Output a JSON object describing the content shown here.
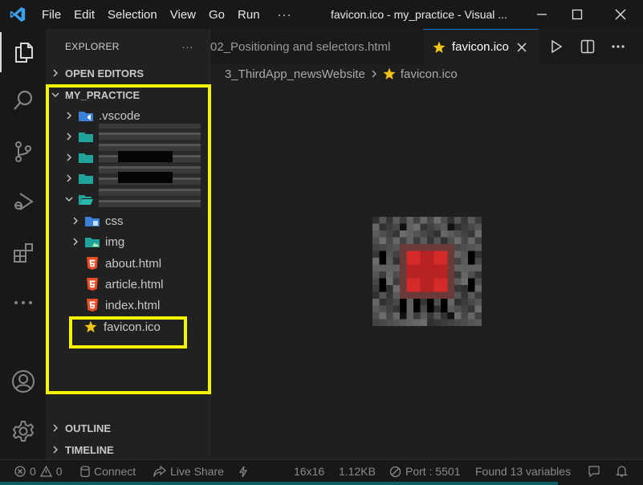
{
  "titlebar": {
    "menu": [
      "File",
      "Edit",
      "Selection",
      "View",
      "Go",
      "Run",
      "···"
    ],
    "window_title": "favicon.ico - my_practice - Visual ..."
  },
  "activity_bar": {
    "icons": [
      "explorer-icon",
      "search-icon",
      "source-control-icon",
      "run-debug-icon",
      "extensions-icon",
      "more-icon",
      "account-icon",
      "settings-gear-icon"
    ]
  },
  "sidebar": {
    "header": "EXPLORER",
    "header_more": "···",
    "open_editors": "OPEN EDITORS",
    "root": "MY_PRACTICE",
    "items": [
      {
        "label": ".vscode",
        "icon": "vscode-folder-icon"
      },
      {
        "label": "",
        "icon": "folder-icon"
      },
      {
        "label": "",
        "icon": "folder-icon"
      },
      {
        "label": "",
        "icon": "folder-icon"
      },
      {
        "label": "",
        "icon": "folder-open-icon"
      },
      {
        "label": "css",
        "icon": "css-folder-icon"
      },
      {
        "label": "img",
        "icon": "img-folder-icon"
      },
      {
        "label": "about.html",
        "icon": "html5-icon"
      },
      {
        "label": "article.html",
        "icon": "html5-icon"
      },
      {
        "label": "index.html",
        "icon": "html5-icon"
      },
      {
        "label": "favicon.ico",
        "icon": "star-icon"
      }
    ],
    "outline": "OUTLINE",
    "timeline": "TIMELINE"
  },
  "tabs": {
    "inactive_label": "02_Positioning and selectors.html",
    "active_label": "favicon.ico"
  },
  "breadcrumb": {
    "folder": "3_ThirdApp_newsWebsite",
    "file": "favicon.ico"
  },
  "statusbar": {
    "errors": "0",
    "warnings": "0",
    "connect": "Connect",
    "live_share": "Live Share",
    "dimensions": "16x16",
    "size": "1.12KB",
    "port": "Port : 5501",
    "variables": "Found 13 variables"
  },
  "colors": {
    "highlight": "#f5f500",
    "accent": "#0078d4",
    "html_icon": "#e44d26",
    "star": "#f0c419",
    "folder": "#1fa39a"
  }
}
